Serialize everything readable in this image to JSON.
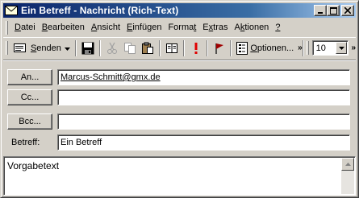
{
  "window": {
    "title": "Ein Betreff - Nachricht (Rich-Text)"
  },
  "menu": {
    "items": [
      {
        "label_u": "D",
        "label_rest": "atei"
      },
      {
        "label_u": "B",
        "label_rest": "earbeiten"
      },
      {
        "label_u": "A",
        "label_rest": "nsicht"
      },
      {
        "label_u": "E",
        "label_rest": "infügen"
      },
      {
        "label_pre": "Forma",
        "label_u": "t",
        "label_rest": ""
      },
      {
        "label_pre": "E",
        "label_u": "x",
        "label_rest": "tras"
      },
      {
        "label_pre": "A",
        "label_u": "k",
        "label_rest": "tionen"
      },
      {
        "label_u": "?",
        "label_rest": ""
      }
    ]
  },
  "toolbar": {
    "send_label_u": "S",
    "send_label_rest": "enden",
    "options_label_pre": "O",
    "options_label_rest": "ptionen...",
    "font_size": "10"
  },
  "fields": {
    "to_label": "An...",
    "to_value": "Marcus-Schmitt@gmx.de",
    "cc_label": "Cc...",
    "cc_value": "",
    "bcc_label": "Bcc...",
    "bcc_value": "",
    "subject_label": "Betreff:",
    "subject_value": "Ein Betreff"
  },
  "body": {
    "text": "Vorgabetext"
  },
  "colors": {
    "title_bar": "#0a246a",
    "flag": "#a00000",
    "exclamation": "#e00000"
  }
}
